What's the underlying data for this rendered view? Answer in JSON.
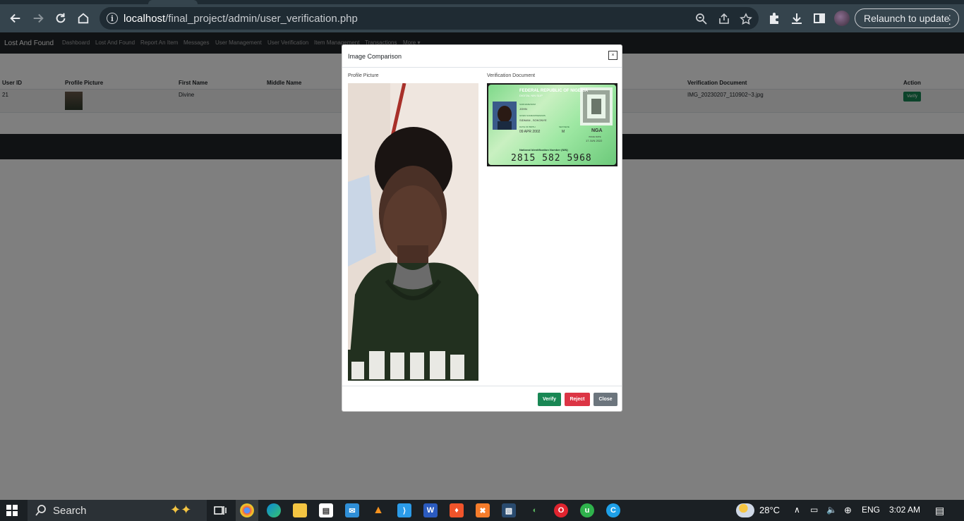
{
  "browser": {
    "url_host": "localhost",
    "url_path": "/final_project/admin/user_verification.php",
    "relaunch_label": "Relaunch to update"
  },
  "site_nav": {
    "brand": "Lost And Found",
    "links": [
      "Dashboard",
      "Lost And Found",
      "Report An Item",
      "Messages",
      "User Management",
      "User Verification",
      "Item Management",
      "Transactions",
      "More ▾"
    ]
  },
  "table": {
    "headers": {
      "user_id": "User ID",
      "profile_picture": "Profile Picture",
      "first_name": "First Name",
      "middle_name": "Middle Name",
      "verification_document": "Verification Document",
      "action": "Action"
    },
    "rows": [
      {
        "user_id": "21",
        "first_name": "Divine",
        "verification_document": "IMG_20230207_110902~3.jpg",
        "action_label": "Verify"
      }
    ]
  },
  "modal": {
    "title": "Image Comparison",
    "close_glyph": "×",
    "profile_label": "Profile Picture",
    "document_label": "Verification Document",
    "id_card": {
      "header": "FEDERAL REPUBLIC OF NIGERIA",
      "subheader": "DIGITAL NIN SLIP",
      "surname_label": "SURNAME/NOM",
      "surname": "JOHN",
      "given_label": "GIVEN NAMES/PRENOMS",
      "given": "SIDMAN , SOKONYE",
      "dob_label": "DATE OF BIRTH",
      "dob": "09 APR 2002",
      "sex_label": "SEX/SEXE",
      "sex": "M",
      "country": "NGA",
      "issue_label": "ISSUE DATE",
      "issue": "17 JUN 2022",
      "nin_label": "National Identification Number (NIN)",
      "nin": "2815 582 5968"
    },
    "buttons": {
      "verify": "Verify",
      "reject": "Reject",
      "close": "Close"
    },
    "colors": {
      "verify": "#198754",
      "reject": "#dc3545",
      "close": "#6c757d"
    }
  },
  "taskbar": {
    "search_label": "Search",
    "weather": "28°C",
    "language": "ENG",
    "time": "3:02 AM"
  }
}
